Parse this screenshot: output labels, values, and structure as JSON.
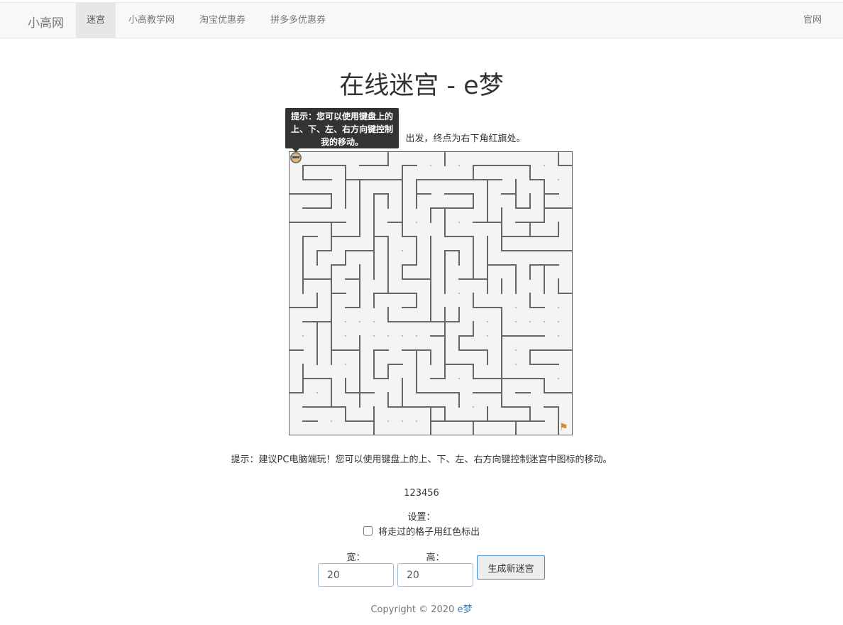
{
  "navbar": {
    "brand": "小高网",
    "items": [
      {
        "label": "迷宫",
        "active": true
      },
      {
        "label": "小高教学网",
        "active": false
      },
      {
        "label": "淘宝优惠券",
        "active": false
      },
      {
        "label": "拼多多优惠券",
        "active": false
      }
    ],
    "right_link": "官网"
  },
  "page": {
    "title": "在线迷宫 - e梦",
    "instruction_visible": "出发，终点为右下角红旗处。",
    "tooltip": "提示：您可以使用键盘上的上、下、左、右方向键控制我的移动。",
    "hint": "提示：建议PC电脑端玩！您可以使用键盘上的上、下、左、右方向键控制迷宫中图标的移动。",
    "code": "123456",
    "settings_label": "设置：",
    "checkbox_label": "将走过的格子用红色标出",
    "checkbox_checked": false,
    "width_label": "宽：",
    "width_value": "20",
    "height_label": "高：",
    "height_value": "20",
    "generate_button": "生成新迷宫",
    "footer_text": "Copyright © 2020 ",
    "footer_link": "e梦"
  },
  "maze": {
    "cols": 20,
    "rows": 20,
    "wall_color": "#666666",
    "bg_color": "#f4f4f4",
    "player_icon": "player-avatar-icon",
    "goal_icon": "red-flag-icon",
    "walls": [
      [
        0,
        0,
        20,
        0
      ],
      [
        0,
        0,
        0,
        20
      ],
      [
        20,
        0,
        20,
        20
      ],
      [
        0,
        20,
        20,
        20
      ],
      [
        1,
        1,
        4,
        1
      ],
      [
        5,
        1,
        7,
        1
      ],
      [
        8,
        1,
        9,
        1
      ],
      [
        7,
        0,
        7,
        1
      ],
      [
        1,
        1,
        1,
        2
      ],
      [
        1,
        2,
        3,
        2
      ],
      [
        4,
        2,
        8,
        2
      ],
      [
        9,
        2,
        10,
        2
      ],
      [
        4,
        1,
        4,
        4
      ],
      [
        5,
        2,
        5,
        5
      ],
      [
        8,
        1,
        8,
        5
      ],
      [
        9,
        2,
        9,
        4
      ],
      [
        0,
        3,
        3,
        3
      ],
      [
        3,
        3,
        3,
        4
      ],
      [
        1,
        4,
        3,
        4
      ],
      [
        6,
        3,
        7,
        3
      ],
      [
        6,
        3,
        6,
        5
      ],
      [
        7,
        3,
        7,
        4
      ],
      [
        9,
        3,
        10,
        3
      ],
      [
        10,
        4,
        10,
        5
      ],
      [
        0,
        5,
        4,
        5
      ],
      [
        7,
        5,
        8,
        5
      ],
      [
        3,
        5,
        3,
        7
      ],
      [
        3,
        6,
        5,
        6
      ],
      [
        5,
        5,
        5,
        6
      ],
      [
        6,
        5,
        6,
        9
      ],
      [
        6,
        6,
        7,
        6
      ],
      [
        7,
        6,
        7,
        10
      ],
      [
        8,
        5,
        8,
        6
      ],
      [
        8,
        6,
        9,
        6
      ],
      [
        9,
        6,
        9,
        8
      ],
      [
        8,
        8,
        9,
        8
      ],
      [
        8,
        8,
        8,
        9
      ],
      [
        8,
        9,
        10,
        9
      ],
      [
        10,
        6,
        10,
        10
      ],
      [
        1,
        6,
        2,
        6
      ],
      [
        1,
        6,
        1,
        10
      ],
      [
        2,
        7,
        3,
        7
      ],
      [
        2,
        7,
        2,
        8
      ],
      [
        4,
        7,
        6,
        7
      ],
      [
        4,
        7,
        4,
        8
      ],
      [
        3,
        8,
        4,
        8
      ],
      [
        3,
        8,
        3,
        10
      ],
      [
        5,
        8,
        5,
        10
      ],
      [
        1,
        9,
        3,
        9
      ],
      [
        4,
        9,
        5,
        9
      ],
      [
        11,
        0,
        11,
        1
      ],
      [
        13,
        1,
        17,
        1
      ],
      [
        13,
        1,
        13,
        2
      ],
      [
        17,
        1,
        17,
        2
      ],
      [
        17,
        2,
        18,
        2
      ],
      [
        18,
        2,
        18,
        4
      ],
      [
        19,
        0,
        19,
        1
      ],
      [
        19,
        1,
        20,
        1
      ],
      [
        20,
        1,
        20,
        2
      ],
      [
        10,
        2,
        15,
        2
      ],
      [
        14,
        2,
        14,
        5
      ],
      [
        16,
        2,
        16,
        4
      ],
      [
        16,
        4,
        17,
        4
      ],
      [
        17,
        3,
        17,
        4
      ],
      [
        15,
        3,
        16,
        3
      ],
      [
        18,
        3,
        19,
        3
      ],
      [
        11,
        3,
        13,
        3
      ],
      [
        13,
        3,
        13,
        4
      ],
      [
        10,
        4,
        13,
        4
      ],
      [
        11,
        4,
        11,
        6
      ],
      [
        15,
        4,
        15,
        6
      ],
      [
        18,
        4,
        20,
        4
      ],
      [
        18,
        4,
        18,
        5
      ],
      [
        13,
        5,
        15,
        5
      ],
      [
        16,
        5,
        18,
        5
      ],
      [
        17,
        5,
        17,
        6
      ],
      [
        19,
        5,
        19,
        6
      ],
      [
        11,
        6,
        13,
        6
      ],
      [
        13,
        6,
        13,
        9
      ],
      [
        10,
        6,
        10,
        7
      ],
      [
        14,
        6,
        14,
        9
      ],
      [
        15,
        6,
        16,
        6
      ],
      [
        15,
        6,
        15,
        7
      ],
      [
        15,
        7,
        20,
        7
      ],
      [
        16,
        6,
        19,
        6
      ],
      [
        11,
        7,
        12,
        7
      ],
      [
        11,
        7,
        11,
        10
      ],
      [
        12,
        7,
        12,
        8
      ],
      [
        14,
        8,
        16,
        8
      ],
      [
        16,
        8,
        16,
        10
      ],
      [
        17,
        8,
        19,
        8
      ],
      [
        17,
        8,
        17,
        9
      ],
      [
        18,
        8,
        18,
        10
      ],
      [
        19,
        9,
        19,
        10
      ],
      [
        12,
        9,
        14,
        9
      ],
      [
        14,
        9,
        14,
        10
      ],
      [
        15,
        9,
        15,
        10
      ],
      [
        0,
        11,
        2,
        11
      ],
      [
        2,
        11,
        2,
        10
      ],
      [
        3,
        10,
        4,
        10
      ],
      [
        3,
        10,
        3,
        15
      ],
      [
        4,
        11,
        5,
        11
      ],
      [
        5,
        10,
        5,
        11
      ],
      [
        6,
        10,
        9,
        10
      ],
      [
        6,
        10,
        6,
        11
      ],
      [
        9,
        10,
        9,
        11
      ],
      [
        8,
        11,
        9,
        11
      ],
      [
        7,
        11,
        7,
        12
      ],
      [
        1,
        12,
        3,
        12
      ],
      [
        2,
        12,
        2,
        15
      ],
      [
        7,
        12,
        10,
        12
      ],
      [
        0,
        14,
        1,
        14
      ],
      [
        3,
        14,
        5,
        14
      ],
      [
        3,
        14,
        3,
        15
      ],
      [
        5,
        13,
        5,
        18
      ],
      [
        6,
        14,
        7,
        14
      ],
      [
        6,
        14,
        6,
        16
      ],
      [
        6,
        16,
        7,
        16
      ],
      [
        7,
        15,
        7,
        16
      ],
      [
        7,
        15,
        8,
        15
      ],
      [
        8,
        14,
        10,
        14
      ],
      [
        9,
        14,
        9,
        17
      ],
      [
        1,
        15,
        1,
        17
      ],
      [
        1,
        16,
        2,
        16
      ],
      [
        2,
        16,
        3,
        16
      ],
      [
        3,
        16,
        3,
        18
      ],
      [
        4,
        16,
        4,
        17
      ],
      [
        4,
        17,
        5,
        17
      ],
      [
        5,
        17,
        6,
        17
      ],
      [
        8,
        16,
        8,
        18
      ],
      [
        9,
        17,
        11,
        17
      ],
      [
        10,
        10,
        10,
        12
      ],
      [
        11,
        11,
        11,
        12
      ],
      [
        10,
        12,
        12,
        12
      ],
      [
        12,
        11,
        12,
        12
      ],
      [
        13,
        10,
        13,
        11
      ],
      [
        13,
        11,
        15,
        11
      ],
      [
        15,
        11,
        15,
        12
      ],
      [
        17,
        10,
        17,
        11
      ],
      [
        17,
        11,
        18,
        11
      ],
      [
        19,
        10,
        20,
        10
      ],
      [
        10,
        13,
        11,
        13
      ],
      [
        11,
        12,
        11,
        16
      ],
      [
        12,
        13,
        13,
        13
      ],
      [
        12,
        13,
        12,
        14
      ],
      [
        12,
        14,
        14,
        14
      ],
      [
        14,
        14,
        14,
        15
      ],
      [
        13,
        12,
        13,
        13
      ],
      [
        15,
        12,
        15,
        17
      ],
      [
        15,
        13,
        18,
        13
      ],
      [
        17,
        14,
        20,
        14
      ],
      [
        17,
        14,
        17,
        15
      ],
      [
        17,
        15,
        19,
        15
      ],
      [
        10,
        14,
        10,
        15
      ],
      [
        11,
        15,
        13,
        15
      ],
      [
        13,
        15,
        13,
        16
      ],
      [
        13,
        16,
        15,
        16
      ],
      [
        10,
        16,
        11,
        16
      ],
      [
        15,
        16,
        18,
        16
      ],
      [
        18,
        16,
        18,
        17
      ],
      [
        18,
        17,
        20,
        17
      ],
      [
        0,
        17,
        1,
        17
      ],
      [
        1,
        18,
        3,
        18
      ],
      [
        3,
        18,
        4,
        18
      ],
      [
        4,
        18,
        4,
        19
      ],
      [
        4,
        19,
        6,
        19
      ],
      [
        6,
        18,
        6,
        20
      ],
      [
        7,
        17,
        7,
        18
      ],
      [
        7,
        18,
        10,
        18
      ],
      [
        10,
        18,
        10,
        20
      ],
      [
        1,
        19,
        2,
        19
      ],
      [
        10,
        17,
        12,
        17
      ],
      [
        12,
        17,
        12,
        18
      ],
      [
        10,
        18,
        11,
        18
      ],
      [
        11,
        18,
        11,
        19
      ],
      [
        10,
        19,
        12,
        19
      ],
      [
        13,
        17,
        15,
        17
      ],
      [
        15,
        17,
        15,
        18
      ],
      [
        15,
        18,
        17,
        18
      ],
      [
        17,
        18,
        17,
        19
      ],
      [
        17,
        19,
        18,
        19
      ],
      [
        16,
        19,
        17,
        19
      ],
      [
        12,
        19,
        13,
        19
      ],
      [
        13,
        19,
        13,
        20
      ],
      [
        13,
        19,
        16,
        19
      ],
      [
        16,
        19,
        16,
        20
      ],
      [
        14,
        18,
        14,
        19
      ],
      [
        18,
        18,
        19,
        18
      ],
      [
        19,
        18,
        19,
        20
      ],
      [
        16,
        17,
        17,
        17
      ]
    ]
  }
}
